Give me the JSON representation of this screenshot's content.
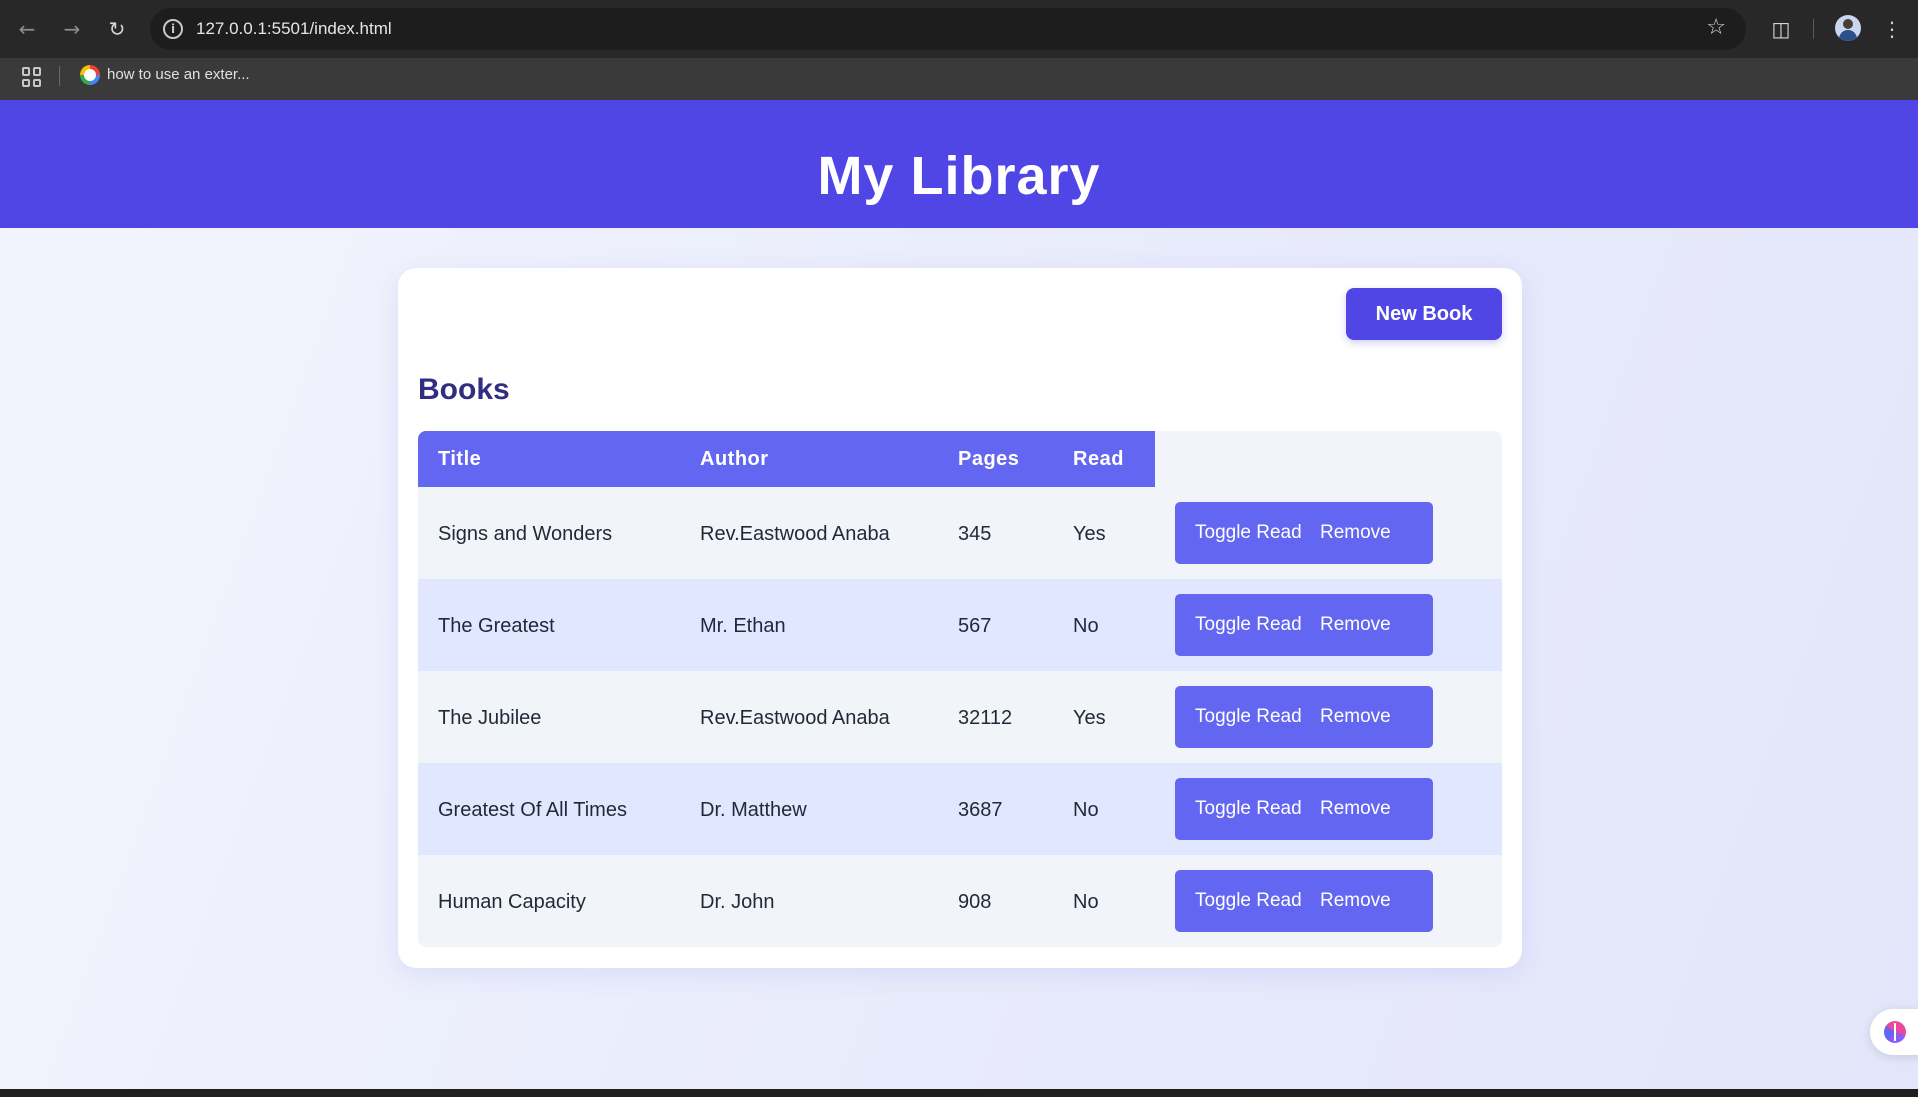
{
  "browser": {
    "url": "127.0.0.1:5501/index.html",
    "bookmark_label": "how to use an exter...",
    "icons": {
      "back": "arrow-left-icon",
      "forward": "arrow-right-icon",
      "reload": "reload-icon",
      "info": "info-icon",
      "star": "star-icon",
      "extensions": "puzzle-icon",
      "menu": "more-vert-icon",
      "apps": "apps-grid-icon"
    }
  },
  "header": {
    "title": "My Library"
  },
  "card": {
    "new_book_label": "New Book",
    "section_title": "Books"
  },
  "table": {
    "columns": [
      "Title",
      "Author",
      "Pages",
      "Read"
    ],
    "rows": [
      {
        "title": "Signs and Wonders",
        "author": "Rev.Eastwood Anaba",
        "pages": "345",
        "read": "Yes"
      },
      {
        "title": "The Greatest",
        "author": "Mr. Ethan",
        "pages": "567",
        "read": "No"
      },
      {
        "title": "The Jubilee",
        "author": "Rev.Eastwood Anaba",
        "pages": "32112",
        "read": "Yes"
      },
      {
        "title": "Greatest Of All Times",
        "author": "Dr. Matthew",
        "pages": "3687",
        "read": "No"
      },
      {
        "title": "Human Capacity",
        "author": "Dr. John",
        "pages": "908",
        "read": "No"
      }
    ],
    "toggle_label": "Toggle Read",
    "remove_label": "Remove"
  },
  "colors": {
    "header_bg": "#4f46e5",
    "button_bg": "#4f46e5",
    "table_header_bg": "#6366f1",
    "action_bg": "#6366f1",
    "row_alt_bg": "#e0e7ff",
    "row_bg": "#f1f5f9",
    "section_title": "#312e81"
  }
}
